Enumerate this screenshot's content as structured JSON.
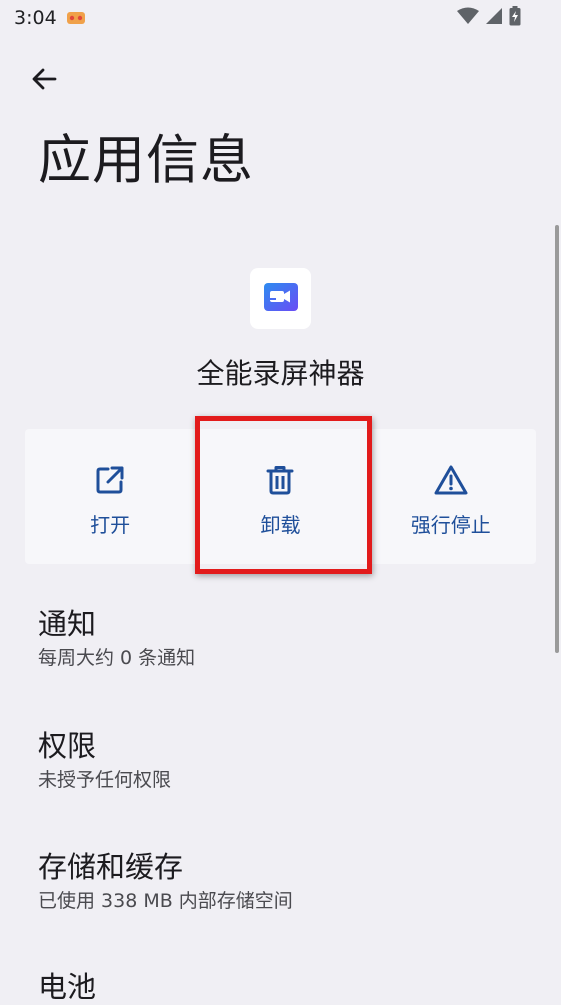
{
  "status_bar": {
    "time": "3:04"
  },
  "header": {
    "title": "应用信息"
  },
  "app": {
    "name": "全能录屏神器"
  },
  "actions": [
    {
      "label": "打开",
      "icon": "open-external-icon"
    },
    {
      "label": "卸载",
      "icon": "trash-icon"
    },
    {
      "label": "强行停止",
      "icon": "warning-icon"
    }
  ],
  "settings": [
    {
      "title": "通知",
      "summary": "每周大约 0 条通知"
    },
    {
      "title": "权限",
      "summary": "未授予任何权限"
    },
    {
      "title": "存储和缓存",
      "summary": "已使用 338 MB 内部存储空间"
    },
    {
      "title": "电池",
      "summary": ""
    }
  ],
  "colors": {
    "accent": "#1f4f9a",
    "background": "#f0eff4",
    "highlight": "#e21b1b"
  }
}
